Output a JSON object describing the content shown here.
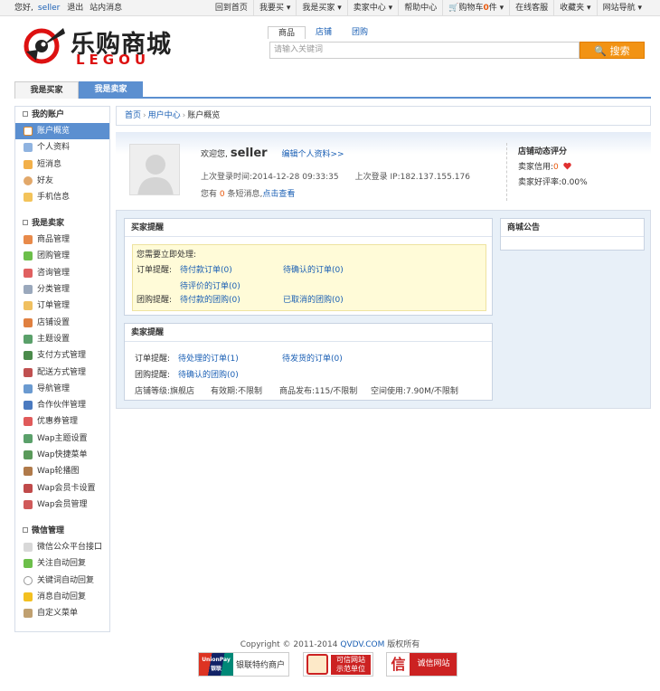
{
  "topbar": {
    "greeting": "您好,",
    "username": "seller",
    "logout": "退出",
    "messages": "站内消息",
    "links": [
      "回到首页",
      "我要买",
      "我是买家",
      "卖家中心",
      "帮助中心"
    ],
    "cart_prefix": "购物车",
    "cart_count": "0",
    "cart_suffix": "件",
    "service": "在线客服",
    "favorites": "收藏夹",
    "sitenav": "网站导航"
  },
  "logo": {
    "cn": "乐购商城",
    "en": "LEGOU"
  },
  "search": {
    "tabs": [
      "商品",
      "店铺",
      "团购"
    ],
    "placeholder": "请输入关键词",
    "button": "搜索"
  },
  "roles": {
    "buyer": "我是买家",
    "seller": "我是卖家"
  },
  "sidebar": {
    "account_title": "我的账户",
    "account_items": [
      "账户概览",
      "个人资料",
      "短消息",
      "好友",
      "手机信息"
    ],
    "seller_title": "我是卖家",
    "seller_items": [
      "商品管理",
      "团购管理",
      "咨询管理",
      "分类管理",
      "订单管理",
      "店铺设置",
      "主题设置",
      "支付方式管理",
      "配送方式管理",
      "导航管理",
      "合作伙伴管理",
      "优惠券管理",
      "Wap主题设置",
      "Wap快捷菜单",
      "Wap轮播图",
      "Wap会员卡设置",
      "Wap会员管理"
    ],
    "wechat_title": "微信管理",
    "wechat_items": [
      "微信公众平台接口",
      "关注自动回复",
      "关键词自动回复",
      "消息自动回复",
      "自定义菜单"
    ]
  },
  "breadcrumb": [
    "首页",
    "用户中心",
    "账户概览"
  ],
  "profile": {
    "welcome": "欢迎您,",
    "username": "seller",
    "edit_link": "编辑个人资料>>",
    "last_login_time_label": "上次登录时间:",
    "last_login_time": "2014-12-28 09:33:35",
    "last_login_ip_label": "上次登录 IP:",
    "last_login_ip": "182.137.155.176",
    "msg_prefix": "您有",
    "msg_count": "0",
    "msg_suffix": "条短消息,",
    "msg_link": "点击查看"
  },
  "store": {
    "title": "店铺动态评分",
    "credit_label": "卖家信用:",
    "credit_value": "0",
    "rate_label": "卖家好评率:",
    "rate_value": "0.00%"
  },
  "buyer_box": {
    "title": "买家提醒",
    "intro": "您需要立即处理:",
    "order_label": "订单提醒:",
    "order_links": [
      "待付款订单(0)",
      "待确认的订单(0)",
      "待评价的订单(0)"
    ],
    "group_label": "团购提醒:",
    "group_links": [
      "待付款的团购(0)",
      "已取消的团购(0)"
    ]
  },
  "seller_box": {
    "title": "卖家提醒",
    "order_label": "订单提醒:",
    "order_links": [
      "待处理的订单(1)",
      "待发货的订单(0)"
    ],
    "group_label": "团购提醒:",
    "group_links": [
      "待确认的团购(0)"
    ],
    "stats": [
      "店铺等级:旗舰店",
      "有效期:不限制",
      "商品发布:115/不限制",
      "空间使用:7.90M/不限制"
    ]
  },
  "notice_box": {
    "title": "商城公告"
  },
  "footer": {
    "prefix": "Copyright © 2011-2014",
    "site": "QVDV.COM",
    "suffix": "版权所有",
    "badges": [
      "银联特约商户",
      "可信网站 示范单位",
      "诚信网站"
    ],
    "unionpay_logo": "UnionPay 银联"
  },
  "colors": {
    "accent": "#5b8fd0",
    "orange": "#f29314",
    "link": "#1a5fb4"
  }
}
